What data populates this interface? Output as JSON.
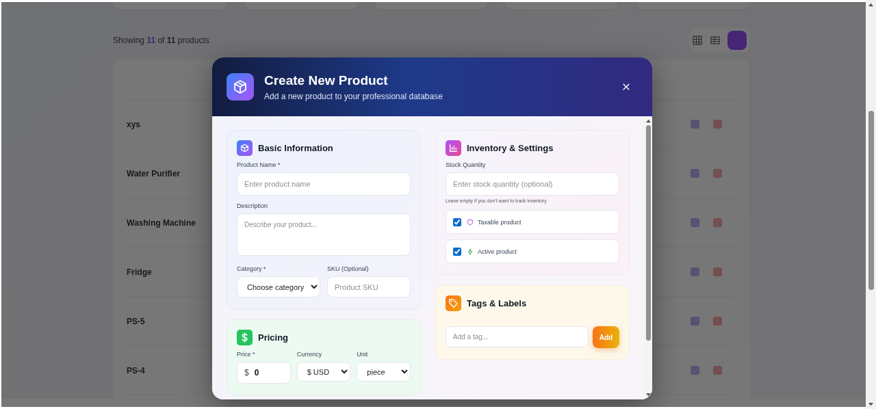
{
  "summary": {
    "prefix": "Showing",
    "shown": "11",
    "middle": "of",
    "total": "11",
    "suffix": "products"
  },
  "products": [
    {
      "name": "xys"
    },
    {
      "name": "Water Purifier"
    },
    {
      "name": "Washing Machine"
    },
    {
      "name": "Fridge"
    },
    {
      "name": "PS-5"
    },
    {
      "name": "PS-4"
    }
  ],
  "modal": {
    "title": "Create New Product",
    "subtitle": "Add a new product to your professional database"
  },
  "basic_info": {
    "title": "Basic Information",
    "product_name": {
      "label": "Product Name *",
      "placeholder": "Enter product name"
    },
    "description": {
      "label": "Description",
      "placeholder": "Describe your product..."
    },
    "category": {
      "label": "Category *",
      "value": "Choose category"
    },
    "sku": {
      "label": "SKU (Optional)",
      "placeholder": "Product SKU"
    }
  },
  "pricing": {
    "title": "Pricing",
    "price": {
      "label": "Price *",
      "symbol": "$",
      "value": "0"
    },
    "currency": {
      "label": "Currency",
      "value": "$ USD"
    },
    "unit": {
      "label": "Unit",
      "value": "piece"
    }
  },
  "inventory": {
    "title": "Inventory & Settings",
    "stock": {
      "label": "Stock Quantity",
      "placeholder": "Enter stock quantity (optional)",
      "hint": "Leave empty if you don't want to track inventory"
    },
    "options": [
      {
        "kind": "taxable",
        "label": "Taxable product",
        "checked": true
      },
      {
        "kind": "active",
        "label": "Active product",
        "checked": true
      }
    ]
  },
  "tags": {
    "title": "Tags & Labels",
    "placeholder": "Add a tag...",
    "button": "Add"
  }
}
